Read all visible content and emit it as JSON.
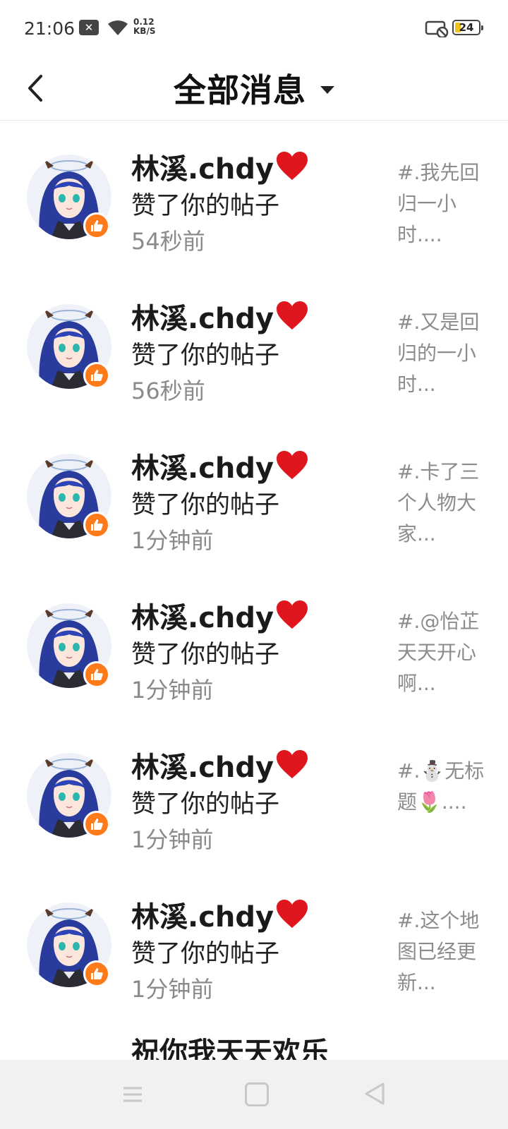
{
  "status_bar": {
    "time": "21:06",
    "speed_value": "0.12",
    "speed_unit": "KB/S",
    "battery": "24"
  },
  "header": {
    "title": "全部消息"
  },
  "notifications": [
    {
      "name": "林溪.chdy",
      "action": "赞了你的帖子",
      "time": "54秒前",
      "preview": "#.我先回归一小时...."
    },
    {
      "name": "林溪.chdy",
      "action": "赞了你的帖子",
      "time": "56秒前",
      "preview": "#.又是回归的一小时..."
    },
    {
      "name": "林溪.chdy",
      "action": "赞了你的帖子",
      "time": "1分钟前",
      "preview": "#.卡了三个人物大家..."
    },
    {
      "name": "林溪.chdy",
      "action": "赞了你的帖子",
      "time": "1分钟前",
      "preview": "#.@怡芷天天开心啊..."
    },
    {
      "name": "林溪.chdy",
      "action": "赞了你的帖子",
      "time": "1分钟前",
      "preview": "#.⛄无标题🌷...."
    },
    {
      "name": "林溪.chdy",
      "action": "赞了你的帖子",
      "time": "1分钟前",
      "preview": "#.这个地图已经更新..."
    }
  ],
  "partial_item": {
    "name": "祝你我天天欢乐"
  },
  "colors": {
    "like_badge": "#ff7a1a",
    "heart": "#e0161f",
    "nav_bar": "#f1f1f1"
  }
}
